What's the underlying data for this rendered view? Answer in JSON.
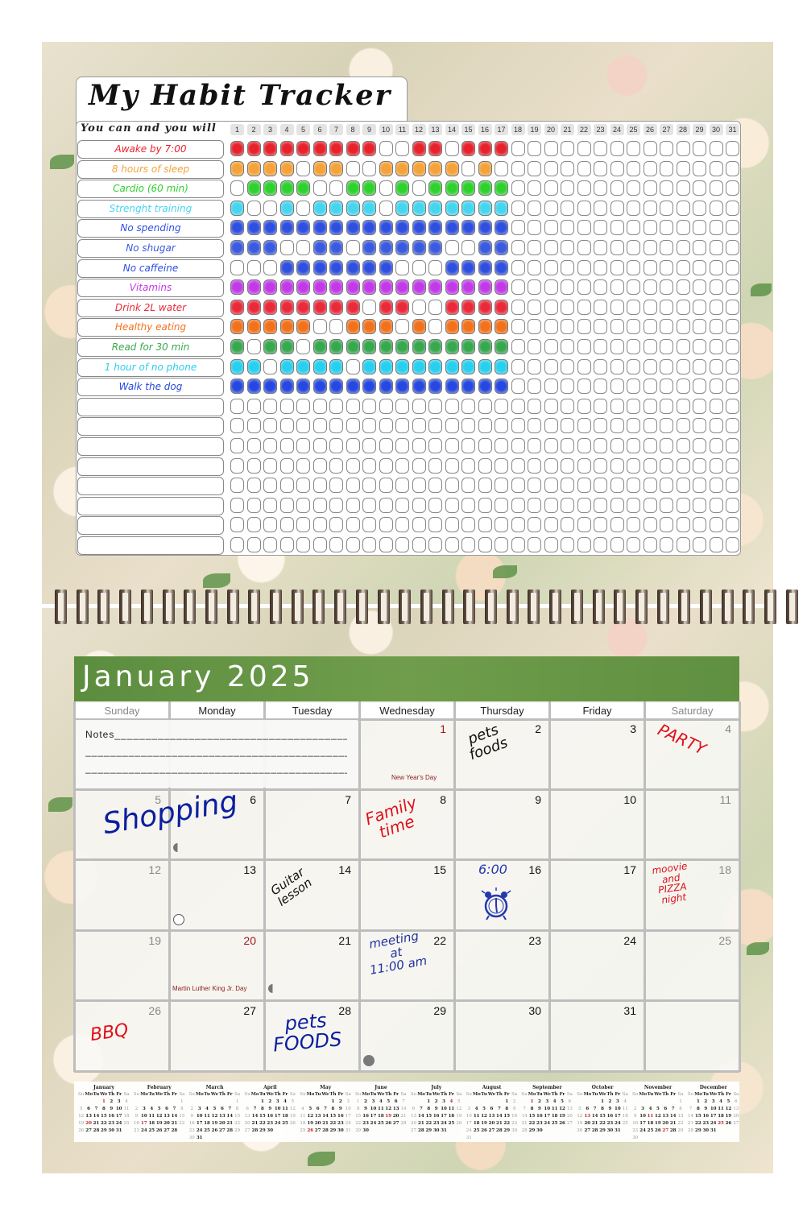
{
  "tracker": {
    "title": "My Habit Tracker",
    "subtitle": "You can and you will",
    "days": [
      "1",
      "2",
      "3",
      "4",
      "5",
      "6",
      "7",
      "8",
      "9",
      "10",
      "11",
      "12",
      "13",
      "14",
      "15",
      "16",
      "17",
      "18",
      "19",
      "20",
      "21",
      "22",
      "23",
      "24",
      "25",
      "26",
      "27",
      "28",
      "29",
      "30",
      "31"
    ],
    "habits": [
      {
        "label": "Awake by 7:00",
        "color": "#e8222c",
        "done": [
          1,
          1,
          1,
          1,
          1,
          1,
          1,
          1,
          1,
          0,
          0,
          1,
          1,
          0,
          1,
          1,
          1
        ]
      },
      {
        "label": "8 hours of sleep",
        "color": "#f4a23a",
        "done": [
          1,
          1,
          1,
          1,
          0,
          1,
          1,
          0,
          0,
          1,
          1,
          1,
          1,
          1,
          0,
          1,
          0
        ]
      },
      {
        "label": "Cardio (60 min)",
        "color": "#2fd12f",
        "done": [
          0,
          1,
          1,
          1,
          1,
          0,
          0,
          1,
          1,
          0,
          1,
          0,
          1,
          1,
          1,
          1,
          1
        ]
      },
      {
        "label": "Strenght training",
        "color": "#45d5ef",
        "done": [
          1,
          0,
          0,
          1,
          0,
          1,
          1,
          1,
          1,
          0,
          1,
          1,
          1,
          1,
          1,
          1,
          1
        ]
      },
      {
        "label": "No spending",
        "color": "#2f4fe0",
        "done": [
          1,
          1,
          1,
          1,
          1,
          1,
          1,
          1,
          1,
          1,
          1,
          1,
          1,
          1,
          1,
          1,
          1
        ]
      },
      {
        "label": "No shugar",
        "color": "#3a5ae0",
        "done": [
          1,
          1,
          1,
          0,
          0,
          1,
          1,
          0,
          1,
          1,
          1,
          1,
          1,
          0,
          0,
          1,
          1
        ]
      },
      {
        "label": "No caffeine",
        "color": "#2f4fe0",
        "done": [
          0,
          0,
          0,
          1,
          1,
          1,
          1,
          1,
          1,
          1,
          0,
          0,
          0,
          1,
          1,
          1,
          1
        ]
      },
      {
        "label": "Vitamins",
        "color": "#c23ae8",
        "done": [
          1,
          1,
          1,
          1,
          1,
          1,
          1,
          1,
          1,
          1,
          1,
          1,
          1,
          1,
          1,
          1,
          1
        ]
      },
      {
        "label": "Drink 2L water",
        "color": "#ea2a3a",
        "done": [
          1,
          1,
          1,
          1,
          1,
          1,
          1,
          1,
          0,
          1,
          1,
          0,
          0,
          1,
          1,
          1,
          1
        ]
      },
      {
        "label": "Healthy eating",
        "color": "#f2721c",
        "done": [
          1,
          1,
          1,
          1,
          1,
          0,
          0,
          1,
          1,
          1,
          0,
          1,
          0,
          1,
          1,
          1,
          1
        ]
      },
      {
        "label": "Read for 30 min",
        "color": "#38a84e",
        "done": [
          1,
          0,
          1,
          1,
          0,
          1,
          1,
          1,
          1,
          1,
          1,
          1,
          1,
          1,
          1,
          1,
          1
        ]
      },
      {
        "label": "1 hour of no phone",
        "color": "#28cfee",
        "done": [
          1,
          1,
          0,
          1,
          1,
          1,
          1,
          0,
          1,
          1,
          1,
          1,
          1,
          1,
          1,
          1,
          1
        ]
      },
      {
        "label": "Walk the dog",
        "color": "#2648e0",
        "done": [
          1,
          1,
          1,
          1,
          1,
          1,
          1,
          1,
          1,
          1,
          1,
          1,
          1,
          1,
          1,
          1,
          1
        ]
      },
      {
        "label": "",
        "color": "#ffffff",
        "done": []
      },
      {
        "label": "",
        "color": "#ffffff",
        "done": []
      },
      {
        "label": "",
        "color": "#ffffff",
        "done": []
      },
      {
        "label": "",
        "color": "#ffffff",
        "done": []
      },
      {
        "label": "",
        "color": "#ffffff",
        "done": []
      },
      {
        "label": "",
        "color": "#ffffff",
        "done": []
      },
      {
        "label": "",
        "color": "#ffffff",
        "done": []
      },
      {
        "label": "",
        "color": "#ffffff",
        "done": []
      }
    ]
  },
  "calendar": {
    "title": "January 2025",
    "weekdays": [
      "Sunday",
      "Monday",
      "Tuesday",
      "Wednesday",
      "Thursday",
      "Friday",
      "Saturday"
    ],
    "notes_label": "Notes",
    "weeks": [
      [
        null,
        null,
        null,
        1,
        2,
        3,
        4
      ],
      [
        5,
        6,
        7,
        8,
        9,
        10,
        11
      ],
      [
        12,
        13,
        14,
        15,
        16,
        17,
        18
      ],
      [
        19,
        20,
        21,
        22,
        23,
        24,
        25
      ],
      [
        26,
        27,
        28,
        29,
        30,
        31,
        null
      ]
    ],
    "holidays": [
      {
        "day": 1,
        "label": "New Year's Day"
      },
      {
        "day": 20,
        "label": "Martin Luther King Jr. Day"
      }
    ],
    "handwritten_notes": [
      {
        "day": 2,
        "text": "pets\nfoods",
        "color": "#111111"
      },
      {
        "day": 4,
        "text": "PARTY",
        "color": "#e0101c"
      },
      {
        "day": 5,
        "text": "Shopping",
        "color": "#0b1f9e"
      },
      {
        "day": 8,
        "text": "Family\ntime",
        "color": "#e0101c"
      },
      {
        "day": 14,
        "text": "Guitar\nlesson",
        "color": "#111111"
      },
      {
        "day": 16,
        "text": "6:00",
        "color": "#2438b0"
      },
      {
        "day": 18,
        "text": "moovie\nand\nPIZZA\nnight",
        "color": "#e0101c"
      },
      {
        "day": 22,
        "text": "meeting\nat\n11:00 am",
        "color": "#22339e"
      },
      {
        "day": 26,
        "text": "BBQ",
        "color": "#e0101c"
      },
      {
        "day": 28,
        "text": "pets\nFOODS",
        "color": "#0b1f9e"
      }
    ],
    "moon_phases": [
      {
        "day": 6,
        "phase": "last-quarter"
      },
      {
        "day": 13,
        "phase": "full-moon"
      },
      {
        "day": 21,
        "phase": "last-quarter"
      },
      {
        "day": 29,
        "phase": "new-moon"
      }
    ]
  },
  "year_overview": {
    "weekday_abbr": [
      "Su",
      "Mo",
      "Tu",
      "We",
      "Th",
      "Fr",
      "Sa"
    ],
    "months": [
      {
        "name": "January",
        "start": 3,
        "days": 31,
        "holidays": [
          1,
          20
        ]
      },
      {
        "name": "February",
        "start": 6,
        "days": 28,
        "holidays": [
          17
        ]
      },
      {
        "name": "March",
        "start": 6,
        "days": 31,
        "holidays": []
      },
      {
        "name": "April",
        "start": 2,
        "days": 30,
        "holidays": []
      },
      {
        "name": "May",
        "start": 4,
        "days": 31,
        "holidays": [
          26
        ]
      },
      {
        "name": "June",
        "start": 0,
        "days": 30,
        "holidays": [
          19
        ]
      },
      {
        "name": "July",
        "start": 2,
        "days": 31,
        "holidays": [
          4
        ]
      },
      {
        "name": "August",
        "start": 5,
        "days": 31,
        "holidays": []
      },
      {
        "name": "September",
        "start": 1,
        "days": 30,
        "holidays": [
          1
        ]
      },
      {
        "name": "October",
        "start": 3,
        "days": 31,
        "holidays": [
          13
        ]
      },
      {
        "name": "November",
        "start": 6,
        "days": 30,
        "holidays": [
          11,
          27
        ]
      },
      {
        "name": "December",
        "start": 1,
        "days": 31,
        "holidays": [
          25
        ]
      }
    ]
  }
}
